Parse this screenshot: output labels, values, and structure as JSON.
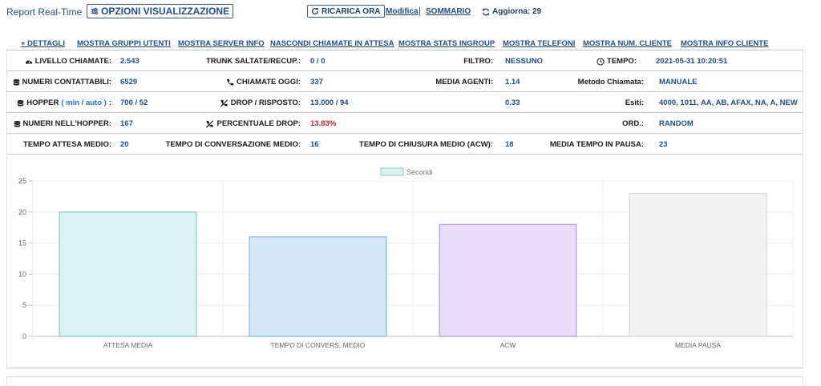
{
  "header": {
    "title": "Report Real-Time",
    "options_label": "OPZIONI VISUALIZZAZIONE",
    "reload_label": "RICARICA ORA",
    "modify_label": "Modifica",
    "separator": "|",
    "summary_label": "SOMMARIO",
    "refresh_label": "Aggiorna: 29"
  },
  "links": [
    "+ DETTAGLI",
    "MOSTRA GRUPPI UTENTI",
    "MOSTRA SERVER INFO",
    "NASCONDI CHIAMATE IN ATTESA",
    "MOSTRA STATS INGROUP",
    "MOSTRA TELEFONI",
    "MOSTRA NUM. CLIENTE",
    "MOSTRA INFO CLIENTE"
  ],
  "stats": {
    "livello_label": "LIVELLO CHIAMATE:",
    "livello_value": "2.543",
    "trunk_label": "TRUNK SALTATE/RECUP.:",
    "trunk_value": "0 / 0",
    "filtro_label": "FILTRO:",
    "filtro_value": "NESSUNO",
    "tempo_label": "TEMPO:",
    "tempo_value": "2021-05-31 10:20:51",
    "numeri_label": "NUMERI CONTATTABILI:",
    "numeri_value": "6529",
    "oggi_label": "CHIAMATE OGGI:",
    "oggi_value": "337",
    "media_agenti_label": "MEDIA AGENTI:",
    "media_agenti_value": "1.14",
    "metodo_label": "Metodo Chiamata:",
    "metodo_value": "MANUALE",
    "hopper_label": "HOPPER",
    "hopper_sub": "( min / auto )",
    "hopper_colon": ":",
    "hopper_value": "700 / 52",
    "drop_label": "DROP / RISPOSTO:",
    "drop_value": "13.000 / 94",
    "row3_extra_value": "0.33",
    "esiti_label": "Esiti:",
    "esiti_value": "4000, 1011, AA, AB, AFAX, NA, A, NEW",
    "nell_hopper_label": "NUMERI NELL'HOPPER:",
    "nell_hopper_value": "167",
    "perc_drop_label": "PERCENTUALE DROP:",
    "perc_drop_value": "13.83%",
    "ord_label": "ORD.:",
    "ord_value": "RANDOM",
    "attesa_label": "TEMPO ATTESA MEDIO:",
    "attesa_value": "20",
    "conv_label": "TEMPO DI CONVERSAZIONE MEDIO:",
    "conv_value": "16",
    "chiusura_label": "TEMPO DI CHIUSURA MEDIO (ACW):",
    "chiusura_value": "18",
    "pausa_label": "MEDIA TEMPO IN PAUSA:",
    "pausa_value": "23"
  },
  "icons": {
    "livello": "dashboard-icon",
    "numeri": "database-icon",
    "hopper": "database-icon",
    "nell_hopper": "database-icon",
    "oggi": "phone-icon",
    "drop": "phone-slash-icon",
    "perc_drop": "phone-slash-icon",
    "tempo": "clock-icon",
    "options": "sliders-icon",
    "reload": "refresh-icon",
    "refresh": "refresh-icon"
  },
  "colors": {
    "link": "#1b4f8a",
    "value": "#1b4f8a",
    "alert": "#e0182b"
  },
  "chart_data": {
    "type": "bar",
    "categories": [
      "ATTESA MEDIA",
      "TEMPO DI CONVERS. MEDIO",
      "ACW",
      "MEDIA PAUSA"
    ],
    "series": [
      {
        "name": "Secondi",
        "values": [
          20,
          16,
          18,
          23
        ]
      }
    ],
    "bar_fill": [
      "#ddf2f2",
      "#d6e8f7",
      "#e9ddfb",
      "#f3f3f3"
    ],
    "bar_stroke": [
      "#7ccccc",
      "#7db7e0",
      "#b596e8",
      "#d6d6d6"
    ],
    "ylim": [
      0,
      25
    ],
    "yticks": [
      0,
      5,
      10,
      15,
      20,
      25
    ],
    "legend_position": "top-center",
    "grid": true
  }
}
